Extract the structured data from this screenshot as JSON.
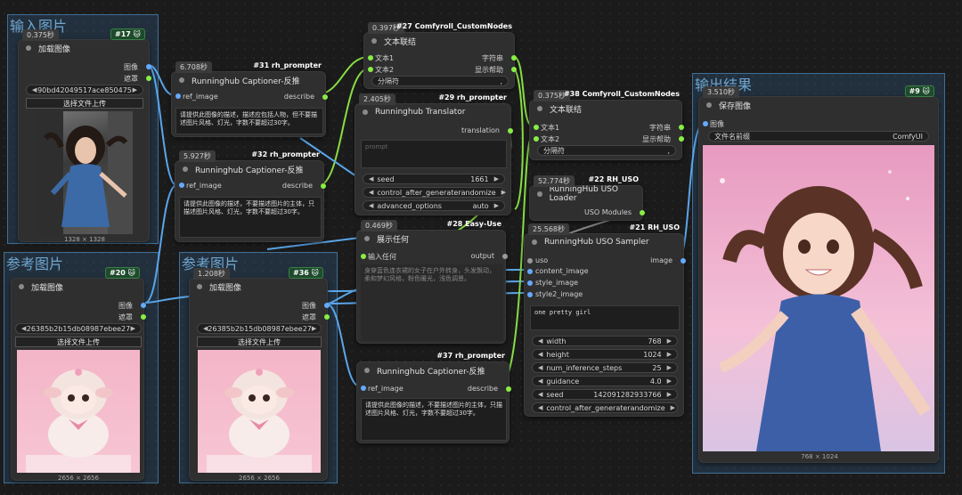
{
  "groups": {
    "input": "输入图片",
    "ref1": "参考图片",
    "ref2": "参考图片",
    "output": "输出结果"
  },
  "n17": {
    "time": "0.375秒",
    "badge": "#17 🐱",
    "title": "加载图像",
    "out_image": "图像",
    "out_mask": "遮罩",
    "file": "90bd42049517ace850475",
    "upload": "选择文件上传",
    "size": "1328 × 1328"
  },
  "n20": {
    "badge": "#20 🐱",
    "title": "加载图像",
    "out_image": "图像",
    "out_mask": "遮罩",
    "file": "26385b2b15db08987ebee27",
    "upload": "选择文件上传",
    "size": "2656 × 2656"
  },
  "n36": {
    "time": "1.208秒",
    "badge": "#36 🐱",
    "title": "加载图像",
    "out_image": "图像",
    "out_mask": "遮罩",
    "file": "26385b2b15db08987ebee27",
    "upload": "选择文件上传",
    "size": "2656 × 2656"
  },
  "n31": {
    "time": "6.708秒",
    "badge": "#31 rh_prompter",
    "title": "Runninghub Captioner-反推",
    "in": "ref_image",
    "out": "describe",
    "text": "请提供此图像的描述，描述应包括人物，但不要描述图片风格、灯光，字数不要超过30字。"
  },
  "n32": {
    "time": "5.927秒",
    "badge": "#32 rh_prompter",
    "title": "Runninghub Captioner-反推",
    "in": "ref_image",
    "out": "describe",
    "text": "请提供此图像的描述，不要描述图片的主体，只描述图片风格、灯光，字数不要超过30字。"
  },
  "n37": {
    "badge": "#37 rh_prompter",
    "title": "Runninghub Captioner-反推",
    "in": "ref_image",
    "out": "describe",
    "text": "请提供此图像的描述，不要描述图片的主体，只描述图片风格、灯光，字数不要超过30字。"
  },
  "n27": {
    "time": "0.397秒",
    "badge": "#27 Comfyroll_CustomNodes",
    "title": "文本联结",
    "in1": "文本1",
    "in2": "文本2",
    "out1": "字符串",
    "out2": "显示帮助",
    "sep": "分隔符",
    "sepval": ","
  },
  "n38": {
    "time": "0.375秒",
    "badge": "#38 Comfyroll_CustomNodes",
    "title": "文本联结",
    "in1": "文本1",
    "in2": "文本2",
    "out1": "字符串",
    "out2": "显示帮助",
    "sep": "分隔符",
    "sepval": ","
  },
  "n29": {
    "time": "2.405秒",
    "badge": "#29 rh_prompter",
    "title": "Runninghub Translator",
    "out": "translation",
    "placeholder": "prompt",
    "seed_label": "seed",
    "seed": "1661",
    "cag_label": "control_after_generate",
    "cag": "randomize",
    "adv_label": "advanced_options",
    "adv": "auto"
  },
  "n28": {
    "time": "0.469秒",
    "badge": "#28 Easy-Use",
    "title": "展示任何",
    "in": "输入任何",
    "out": "output",
    "text": "身穿蓝色连衣裙的女子在户外转身，头发飘动，柔和梦幻风格，粉色暖光，浅色调景。"
  },
  "n22": {
    "time": "52.774秒",
    "badge": "#22 RH_USO",
    "title": "RunningHub USO Loader",
    "out": "USO Modules"
  },
  "n21": {
    "time": "25.568秒",
    "badge": "#21 RH_USO",
    "title": "RunningHub USO Sampler",
    "in_uso": "uso",
    "in_content": "content_image",
    "in_style": "style_image",
    "in_style2": "style2_image",
    "out": "image",
    "prompt": "one pretty girl",
    "width_label": "width",
    "width": "768",
    "height_label": "height",
    "height": "1024",
    "steps_label": "num_inference_steps",
    "steps": "25",
    "guid_label": "guidance",
    "guid": "4.0",
    "seed_label": "seed",
    "seed": "142091282933766",
    "cag_label": "control_after_generate",
    "cag": "randomize"
  },
  "n9": {
    "time": "3.510秒",
    "badge": "#9 🐱",
    "title": "保存图像",
    "in": "图像",
    "prefix_label": "文件名前缀",
    "prefix": "ComfyUI",
    "size": "768 × 1024"
  }
}
